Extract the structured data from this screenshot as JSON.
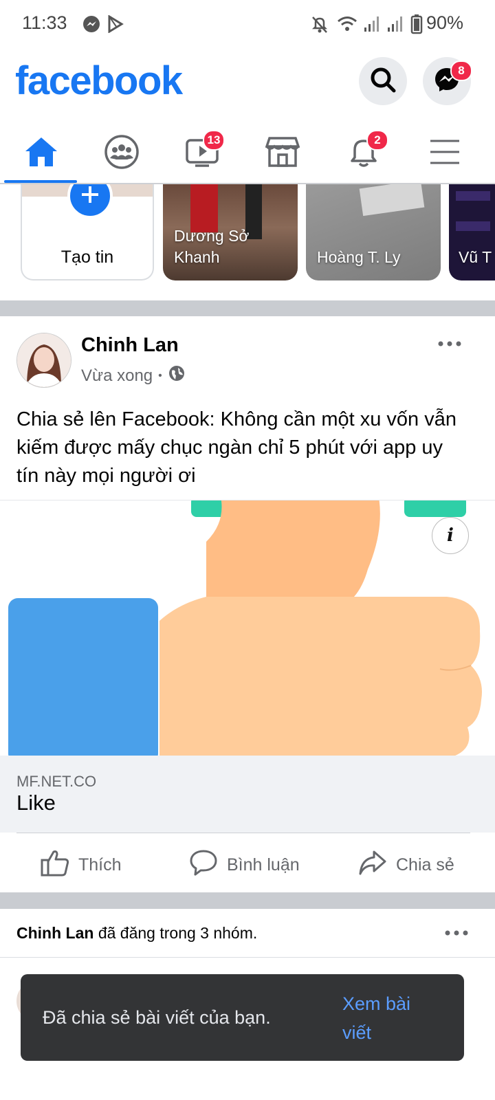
{
  "status": {
    "time": "11:33",
    "battery": "90%"
  },
  "header": {
    "logo": "facebook",
    "messenger_badge": "8"
  },
  "nav": {
    "video_badge": "13",
    "notifications_badge": "2"
  },
  "stories": {
    "create_label": "Tạo tin",
    "items": [
      {
        "name": "Dương Sở Khanh"
      },
      {
        "name": "Hoàng T. Ly"
      },
      {
        "name": "Vũ T"
      }
    ]
  },
  "post": {
    "author": "Chinh Lan",
    "time": "Vừa xong",
    "text": "Chia sẻ lên Facebook: Không cần một xu vốn vẫn kiếm được mấy chục ngàn chỉ 5 phút với app uy tín này mọi người ơi",
    "link_domain": "MF.NET.CO",
    "link_title": "Like",
    "actions": {
      "like": "Thích",
      "comment": "Bình luận",
      "share": "Chia sẻ"
    }
  },
  "post2": {
    "author": "Chinh Lan",
    "shared_text": "đã đăng trong 3 nhóm."
  },
  "toast": {
    "message": "Đã chia sẻ bài viết của bạn.",
    "action": "Xem bài viết"
  },
  "colors": {
    "brand": "#1877f2",
    "badge": "#f02849",
    "toast_bg": "#333436",
    "toast_link": "#5b9dff"
  }
}
